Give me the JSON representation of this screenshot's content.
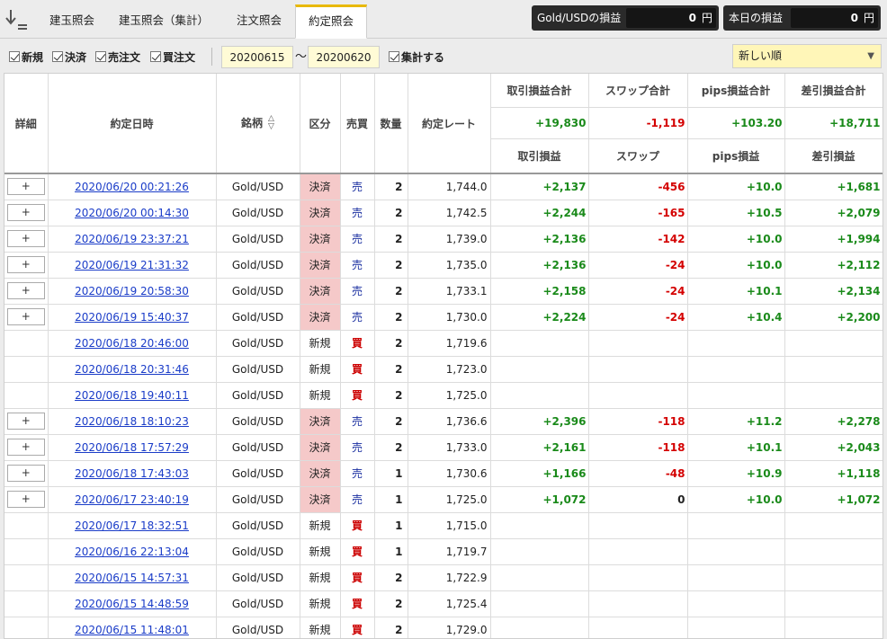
{
  "tabs": [
    {
      "label": "建玉照会",
      "active": false
    },
    {
      "label": "建玉照会（集計）",
      "active": false
    },
    {
      "label": "注文照会",
      "active": false
    },
    {
      "label": "約定照会",
      "active": true
    }
  ],
  "pnl": {
    "gold_label": "Gold/USDの損益",
    "gold_value": "0",
    "today_label": "本日の損益",
    "today_value": "0",
    "unit": "円"
  },
  "filters": {
    "new_label": "新規",
    "settle_label": "決済",
    "sell_order_label": "売注文",
    "buy_order_label": "買注文",
    "date_from": "20200615",
    "tilde": "〜",
    "date_to": "20200620",
    "aggregate_label": "集計する",
    "sort_value": "新しい順"
  },
  "headers": {
    "detail": "詳細",
    "datetime": "約定日時",
    "symbol": "銘柄",
    "kubun": "区分",
    "side": "売買",
    "qty": "数量",
    "rate": "約定レート",
    "sum_trade_pl": "取引損益合計",
    "sum_swap": "スワップ合計",
    "sum_pips": "pips損益合計",
    "sum_net": "差引損益合計",
    "trade_pl": "取引損益",
    "swap": "スワップ",
    "pips": "pips損益",
    "net": "差引損益"
  },
  "totals": {
    "trade_pl": "+19,830",
    "swap": "-1,119",
    "pips": "+103.20",
    "net": "+18,711"
  },
  "detail_button_label": "+",
  "rows": [
    {
      "datetime": "2020/06/20 00:21:26",
      "symbol": "Gold/USD",
      "kubun": "決済",
      "side": "売",
      "qty": "2",
      "rate": "1,744.0",
      "trade_pl": "+2,137",
      "swap": "-456",
      "pips": "+10.0",
      "net": "+1,681"
    },
    {
      "datetime": "2020/06/20 00:14:30",
      "symbol": "Gold/USD",
      "kubun": "決済",
      "side": "売",
      "qty": "2",
      "rate": "1,742.5",
      "trade_pl": "+2,244",
      "swap": "-165",
      "pips": "+10.5",
      "net": "+2,079"
    },
    {
      "datetime": "2020/06/19 23:37:21",
      "symbol": "Gold/USD",
      "kubun": "決済",
      "side": "売",
      "qty": "2",
      "rate": "1,739.0",
      "trade_pl": "+2,136",
      "swap": "-142",
      "pips": "+10.0",
      "net": "+1,994"
    },
    {
      "datetime": "2020/06/19 21:31:32",
      "symbol": "Gold/USD",
      "kubun": "決済",
      "side": "売",
      "qty": "2",
      "rate": "1,735.0",
      "trade_pl": "+2,136",
      "swap": "-24",
      "pips": "+10.0",
      "net": "+2,112"
    },
    {
      "datetime": "2020/06/19 20:58:30",
      "symbol": "Gold/USD",
      "kubun": "決済",
      "side": "売",
      "qty": "2",
      "rate": "1,733.1",
      "trade_pl": "+2,158",
      "swap": "-24",
      "pips": "+10.1",
      "net": "+2,134"
    },
    {
      "datetime": "2020/06/19 15:40:37",
      "symbol": "Gold/USD",
      "kubun": "決済",
      "side": "売",
      "qty": "2",
      "rate": "1,730.0",
      "trade_pl": "+2,224",
      "swap": "-24",
      "pips": "+10.4",
      "net": "+2,200"
    },
    {
      "datetime": "2020/06/18 20:46:00",
      "symbol": "Gold/USD",
      "kubun": "新規",
      "side": "買",
      "qty": "2",
      "rate": "1,719.6",
      "trade_pl": "",
      "swap": "",
      "pips": "",
      "net": ""
    },
    {
      "datetime": "2020/06/18 20:31:46",
      "symbol": "Gold/USD",
      "kubun": "新規",
      "side": "買",
      "qty": "2",
      "rate": "1,723.0",
      "trade_pl": "",
      "swap": "",
      "pips": "",
      "net": ""
    },
    {
      "datetime": "2020/06/18 19:40:11",
      "symbol": "Gold/USD",
      "kubun": "新規",
      "side": "買",
      "qty": "2",
      "rate": "1,725.0",
      "trade_pl": "",
      "swap": "",
      "pips": "",
      "net": ""
    },
    {
      "datetime": "2020/06/18 18:10:23",
      "symbol": "Gold/USD",
      "kubun": "決済",
      "side": "売",
      "qty": "2",
      "rate": "1,736.6",
      "trade_pl": "+2,396",
      "swap": "-118",
      "pips": "+11.2",
      "net": "+2,278"
    },
    {
      "datetime": "2020/06/18 17:57:29",
      "symbol": "Gold/USD",
      "kubun": "決済",
      "side": "売",
      "qty": "2",
      "rate": "1,733.0",
      "trade_pl": "+2,161",
      "swap": "-118",
      "pips": "+10.1",
      "net": "+2,043"
    },
    {
      "datetime": "2020/06/18 17:43:03",
      "symbol": "Gold/USD",
      "kubun": "決済",
      "side": "売",
      "qty": "1",
      "rate": "1,730.6",
      "trade_pl": "+1,166",
      "swap": "-48",
      "pips": "+10.9",
      "net": "+1,118"
    },
    {
      "datetime": "2020/06/17 23:40:19",
      "symbol": "Gold/USD",
      "kubun": "決済",
      "side": "売",
      "qty": "1",
      "rate": "1,725.0",
      "trade_pl": "+1,072",
      "swap": "0",
      "pips": "+10.0",
      "net": "+1,072"
    },
    {
      "datetime": "2020/06/17 18:32:51",
      "symbol": "Gold/USD",
      "kubun": "新規",
      "side": "買",
      "qty": "1",
      "rate": "1,715.0",
      "trade_pl": "",
      "swap": "",
      "pips": "",
      "net": ""
    },
    {
      "datetime": "2020/06/16 22:13:04",
      "symbol": "Gold/USD",
      "kubun": "新規",
      "side": "買",
      "qty": "1",
      "rate": "1,719.7",
      "trade_pl": "",
      "swap": "",
      "pips": "",
      "net": ""
    },
    {
      "datetime": "2020/06/15 14:57:31",
      "symbol": "Gold/USD",
      "kubun": "新規",
      "side": "買",
      "qty": "2",
      "rate": "1,722.9",
      "trade_pl": "",
      "swap": "",
      "pips": "",
      "net": ""
    },
    {
      "datetime": "2020/06/15 14:48:59",
      "symbol": "Gold/USD",
      "kubun": "新規",
      "side": "買",
      "qty": "2",
      "rate": "1,725.4",
      "trade_pl": "",
      "swap": "",
      "pips": "",
      "net": ""
    },
    {
      "datetime": "2020/06/15 11:48:01",
      "symbol": "Gold/USD",
      "kubun": "新規",
      "side": "買",
      "qty": "2",
      "rate": "1,729.0",
      "trade_pl": "",
      "swap": "",
      "pips": "",
      "net": ""
    }
  ]
}
